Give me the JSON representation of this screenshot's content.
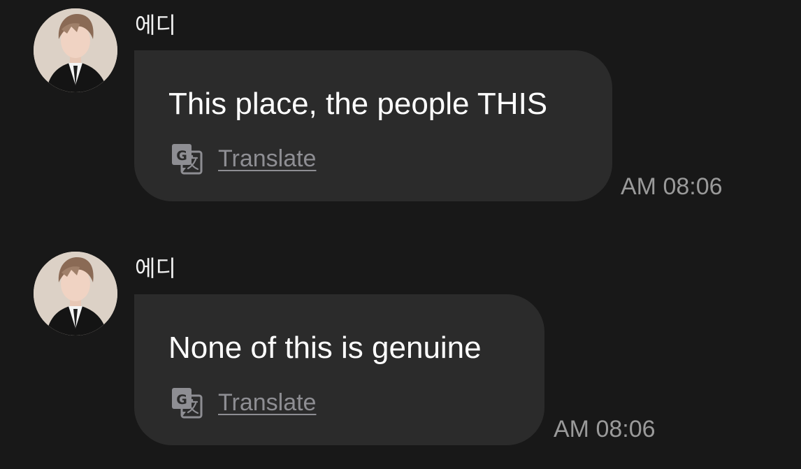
{
  "messages": [
    {
      "sender": "에디",
      "text": "This place, the people THIS",
      "translate_label": "Translate",
      "time": "AM 08:06"
    },
    {
      "sender": "에디",
      "text": "None of this is genuine",
      "translate_label": "Translate",
      "time": "AM 08:06"
    }
  ],
  "icons": {
    "avatar": "profile-photo",
    "translate": "google-translate-icon"
  },
  "colors": {
    "background": "#181818",
    "bubble": "#2b2b2b",
    "muted_text": "#8e8e93"
  }
}
